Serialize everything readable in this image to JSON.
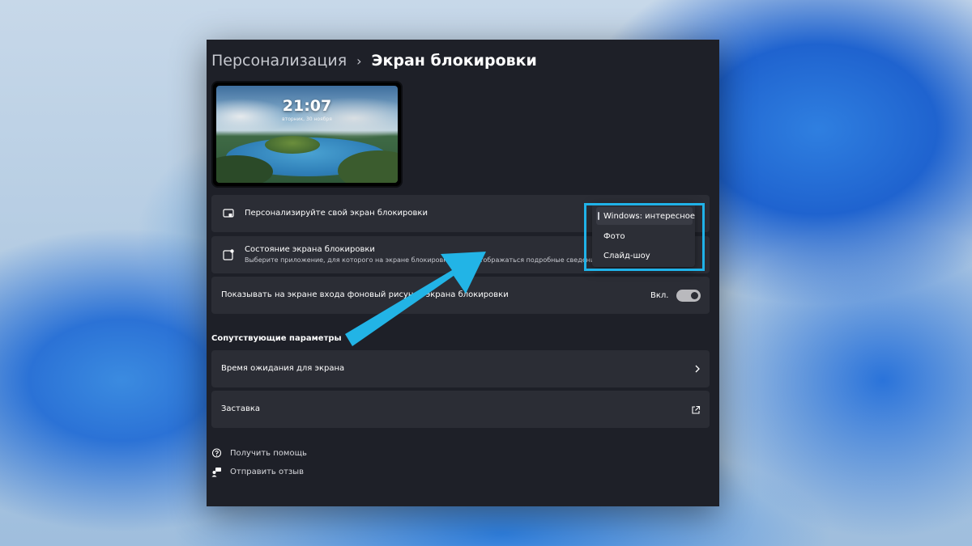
{
  "breadcrumb": {
    "parent": "Персонализация",
    "separator": "›",
    "current": "Экран блокировки"
  },
  "preview": {
    "time": "21:07",
    "date": "вторник, 30 ноября"
  },
  "settings": {
    "personalize": {
      "title": "Персонализируйте свой экран блокировки"
    },
    "status": {
      "title": "Состояние экрана блокировки",
      "subtitle": "Выберите приложение, для которого на экране блокировки будут отображаться подробные сведения о состоянии"
    },
    "signin_background": {
      "title": "Показывать на экране входа фоновый рисунок экрана блокировки",
      "toggle_label": "Вкл.",
      "toggle_on": true
    }
  },
  "related": {
    "title": "Сопутствующие параметры",
    "items": [
      {
        "label": "Время ожидания для экрана",
        "icon": "chevron-right-icon"
      },
      {
        "label": "Заставка",
        "icon": "external-link-icon"
      }
    ]
  },
  "dropdown": {
    "selected": "Windows: интересное",
    "options": [
      "Windows: интересное",
      "Фото",
      "Слайд-шоу"
    ]
  },
  "footer_links": [
    {
      "label": "Получить помощь",
      "icon": "help-icon"
    },
    {
      "label": "Отправить отзыв",
      "icon": "feedback-icon"
    }
  ],
  "colors": {
    "window_bg": "#1e2028",
    "card_bg": "#2b2d35",
    "highlight": "#20b2e8",
    "arrow": "#22b4e6"
  }
}
